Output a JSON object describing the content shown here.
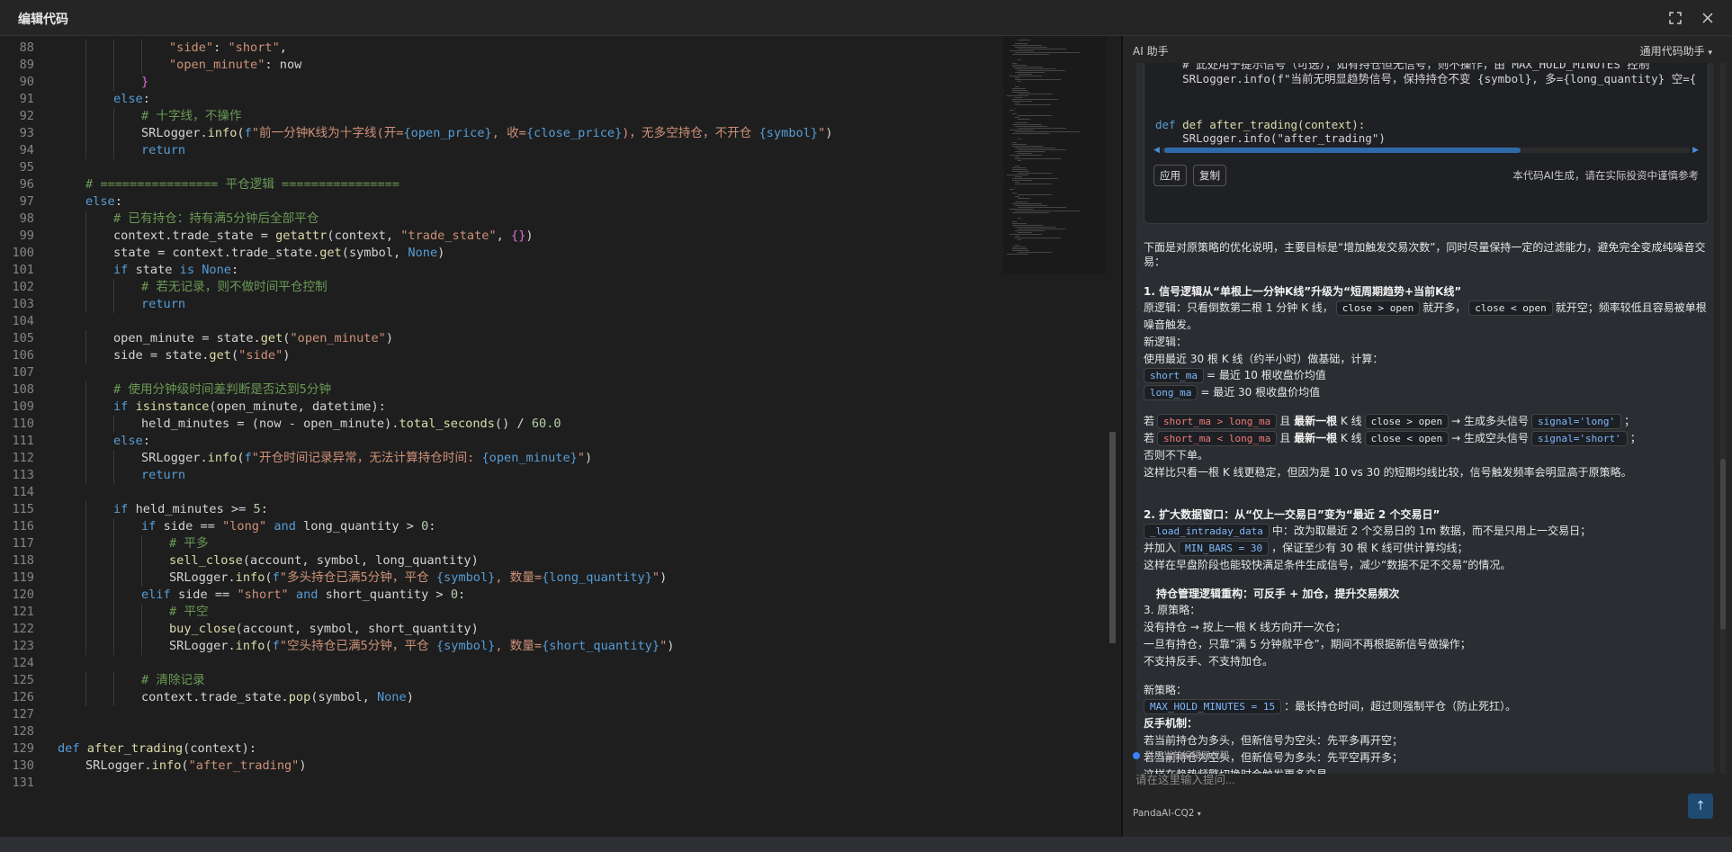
{
  "window": {
    "title": "编辑代码",
    "fullscreen_icon": "fullscreen-icon",
    "close_icon": "close-icon"
  },
  "editor": {
    "lines": [
      {
        "n": "88",
        "i": 4,
        "t": "\"side\": \"short\","
      },
      {
        "n": "89",
        "i": 4,
        "t": "\"open_minute\": now"
      },
      {
        "n": "90",
        "i": 3,
        "t": "}"
      },
      {
        "n": "91",
        "i": 2,
        "t": "else:"
      },
      {
        "n": "92",
        "i": 3,
        "t": "# 十字线，不操作"
      },
      {
        "n": "93",
        "i": 3,
        "t": "SRLogger.info(f\"前一分钟K线为十字线(开={open_price}, 收={close_price})，无多空持仓，不开仓 {symbol}\")"
      },
      {
        "n": "94",
        "i": 3,
        "t": "return"
      },
      {
        "n": "95",
        "i": 0,
        "t": ""
      },
      {
        "n": "96",
        "i": 1,
        "t": "# ================ 平仓逻辑 ================"
      },
      {
        "n": "97",
        "i": 1,
        "t": "else:"
      },
      {
        "n": "98",
        "i": 2,
        "t": "# 已有持仓：持有满5分钟后全部平仓"
      },
      {
        "n": "99",
        "i": 2,
        "t": "context.trade_state = getattr(context, \"trade_state\", {})"
      },
      {
        "n": "100",
        "i": 2,
        "t": "state = context.trade_state.get(symbol, None)"
      },
      {
        "n": "101",
        "i": 2,
        "t": "if state is None:"
      },
      {
        "n": "102",
        "i": 3,
        "t": "# 若无记录，则不做时间平仓控制"
      },
      {
        "n": "103",
        "i": 3,
        "t": "return"
      },
      {
        "n": "104",
        "i": 0,
        "t": ""
      },
      {
        "n": "105",
        "i": 2,
        "t": "open_minute = state.get(\"open_minute\")"
      },
      {
        "n": "106",
        "i": 2,
        "t": "side = state.get(\"side\")"
      },
      {
        "n": "107",
        "i": 0,
        "t": ""
      },
      {
        "n": "108",
        "i": 2,
        "t": "# 使用分钟级时间差判断是否达到5分钟"
      },
      {
        "n": "109",
        "i": 2,
        "t": "if isinstance(open_minute, datetime):"
      },
      {
        "n": "110",
        "i": 3,
        "t": "held_minutes = (now - open_minute).total_seconds() / 60.0"
      },
      {
        "n": "111",
        "i": 2,
        "t": "else:"
      },
      {
        "n": "112",
        "i": 3,
        "t": "SRLogger.info(f\"开仓时间记录异常，无法计算持仓时间: {open_minute}\")"
      },
      {
        "n": "113",
        "i": 3,
        "t": "return"
      },
      {
        "n": "114",
        "i": 0,
        "t": ""
      },
      {
        "n": "115",
        "i": 2,
        "t": "if held_minutes >= 5:"
      },
      {
        "n": "116",
        "i": 3,
        "t": "if side == \"long\" and long_quantity > 0:"
      },
      {
        "n": "117",
        "i": 4,
        "t": "# 平多"
      },
      {
        "n": "118",
        "i": 4,
        "t": "sell_close(account, symbol, long_quantity)"
      },
      {
        "n": "119",
        "i": 4,
        "t": "SRLogger.info(f\"多头持仓已满5分钟，平仓 {symbol}, 数量={long_quantity}\")"
      },
      {
        "n": "120",
        "i": 3,
        "t": "elif side == \"short\" and short_quantity > 0:"
      },
      {
        "n": "121",
        "i": 4,
        "t": "# 平空"
      },
      {
        "n": "122",
        "i": 4,
        "t": "buy_close(account, symbol, short_quantity)"
      },
      {
        "n": "123",
        "i": 4,
        "t": "SRLogger.info(f\"空头持仓已满5分钟，平仓 {symbol}, 数量={short_quantity}\")"
      },
      {
        "n": "124",
        "i": 0,
        "t": ""
      },
      {
        "n": "125",
        "i": 3,
        "t": "# 清除记录"
      },
      {
        "n": "126",
        "i": 3,
        "t": "context.trade_state.pop(symbol, None)"
      },
      {
        "n": "127",
        "i": 0,
        "t": ""
      },
      {
        "n": "128",
        "i": 0,
        "t": ""
      },
      {
        "n": "129",
        "i": 0,
        "t": "def after_trading(context):"
      },
      {
        "n": "130",
        "i": 1,
        "t": "SRLogger.info(\"after_trading\")"
      },
      {
        "n": "131",
        "i": 0,
        "t": ""
      }
    ]
  },
  "assistant": {
    "title": "AI 助手",
    "mode": "通用代码助手",
    "mode_icon": "chevron-down-icon",
    "code_snippet": {
      "lines": [
        "    # 此处用于提示信号（可选），如有持仓但无信号，则不操作，由 MAX_HOLD_MINUTES 控制",
        "    SRLogger.info(f\"当前无明显趋势信号，保持持仓不变 {symbol}, 多={long_quantity} 空={short_quantity}\")",
        "",
        "",
        "def after_trading(context):",
        "    SRLogger.info(\"after_trading\")"
      ],
      "apply_label": "应用",
      "copy_label": "复制",
      "note": "本代码AI生成，请在实际投资中谨慎参考"
    },
    "explain": {
      "intro1": "下面是对原策略的优化说明，主要目标是“增加触发交易次数”，同时尽量保持一定的过滤能力，避免完全变成纯噪音交",
      "intro2": "易：",
      "s1_title": "1. 信号逻辑从“单根上一分钟K线”升级为“短周期趋势+当前K线”",
      "s1_orig_a": "原逻辑：只看倒数第二根 1 分钟 K 线，",
      "s1_orig_chip1": "close > open",
      "s1_orig_b": "就开多，",
      "s1_orig_chip2": "close < open",
      "s1_orig_c": "就开空；频率较低且容易被单根",
      "s1_orig_d": "噪音触发。",
      "s1_new": "新逻辑：",
      "s1_new2": "使用最近 30 根 K 线（约半小时）做基础，计算：",
      "s1_short_chip": "short_ma",
      "s1_short_txt": "= 最近 10 根收盘价均值",
      "s1_long_chip": "long_ma",
      "s1_long_txt": "= 最近 30 根收盘价均值",
      "s1_if": "若",
      "s1_c1": "short_ma > long_ma",
      "s1_and": "且",
      "s1_latest": "最新一根",
      "s1_k": "K 线",
      "s1_c2": "close > open",
      "s1_gen_long": "→ 生成多头信号",
      "s1_sig_long": "signal='long'",
      "s1_c3": "short_ma < long_ma",
      "s1_c4": "close < open",
      "s1_gen_short": "→ 生成空头信号",
      "s1_sig_short": "signal='short'",
      "s1_semi": "；",
      "s1_else": "否则不下单。",
      "s1_note": "这样比只看一根 K 线更稳定，但因为是 10 vs 30 的短期均线比较，信号触发频率会明显高于原策略。",
      "s2_title": "2. 扩大数据窗口：从“仅上一交易日”变为“最近 2 个交易日”",
      "s2_chip1": "_load_intraday_data",
      "s2_t1": "中：改为取最近 2 个交易日的 1m 数据，而不是只用上一交易日；",
      "s2_t2a": "并加入",
      "s2_chip2": "MIN_BARS = 30",
      "s2_t2b": "，保证至少有 30 根 K 线可供计算均线；",
      "s2_t3": "这样在早盘阶段也能较快满足条件生成信号，减少“数据不足不交易”的情况。",
      "s3_title": "持仓管理逻辑重构：可反手 + 加仓，提升交易频次",
      "s3_orig": "3. 原策略：",
      "s3_o1": "没有持仓 → 按上一根 K 线方向开一次仓；",
      "s3_o2": "一旦有持仓，只靠“满 5 分钟就平仓”，期间不再根据新信号做操作；",
      "s3_o3": "不支持反手、不支持加仓。",
      "s3_new": "新策略：",
      "s3_chip": "MAX_HOLD_MINUTES = 15",
      "s3_n1": "：最长持仓时间，超过则强制平仓（防止死扛）。",
      "s3_rev": "反手机制：",
      "s3_r1": "若当前持仓为多头，但新信号为空头：先平多再开空；",
      "s3_r2": "若当前持仓为空头，但新信号为多头：先平空再开多；",
      "s3_r3": "这样在趋势频繁切换时会触发更多交易。"
    },
    "reference_label": "引用当前编辑器代码",
    "input_placeholder": "请在这里输入提问...",
    "model": "PandaAI-CQ2"
  }
}
